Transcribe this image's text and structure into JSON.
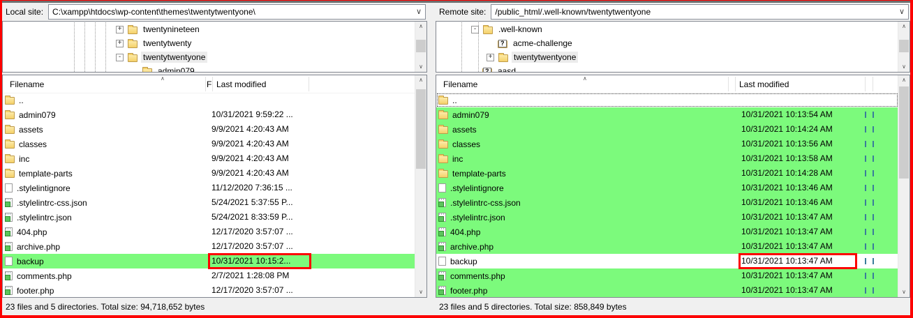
{
  "colors": {
    "compare_green": "#7cfa7c",
    "annotation_red": "#fd0000"
  },
  "local": {
    "label": "Local site:",
    "path": "C:\\xampp\\htdocs\\wp-content\\themes\\twentytwentyone\\",
    "tree": [
      {
        "name": "twentynineteen",
        "expander": "+",
        "icon": "folder",
        "level": 0,
        "selected": false
      },
      {
        "name": "twentytwenty",
        "expander": "+",
        "icon": "folder",
        "level": 0,
        "selected": false
      },
      {
        "name": "twentytwentyone",
        "expander": "-",
        "icon": "folder",
        "level": 0,
        "selected": true
      },
      {
        "name": "admin079",
        "expander": "",
        "icon": "folder",
        "level": 1,
        "selected": false
      }
    ],
    "columns": [
      "Filename",
      "F",
      "Last modified"
    ],
    "rows": [
      {
        "name": "..",
        "icon": "folder",
        "modified": "",
        "highlight": false
      },
      {
        "name": "admin079",
        "icon": "folder",
        "modified": "10/31/2021 9:59:22 ...",
        "highlight": false
      },
      {
        "name": "assets",
        "icon": "folder",
        "modified": "9/9/2021 4:20:43 AM",
        "highlight": false
      },
      {
        "name": "classes",
        "icon": "folder",
        "modified": "9/9/2021 4:20:43 AM",
        "highlight": false
      },
      {
        "name": "inc",
        "icon": "folder",
        "modified": "9/9/2021 4:20:43 AM",
        "highlight": false
      },
      {
        "name": "template-parts",
        "icon": "folder",
        "modified": "9/9/2021 4:20:43 AM",
        "highlight": false
      },
      {
        "name": ".stylelintignore",
        "icon": "file",
        "modified": "11/12/2020 7:36:15 ...",
        "highlight": false
      },
      {
        "name": ".stylelintrc-css.json",
        "icon": "script",
        "modified": "5/24/2021 5:37:55 P...",
        "highlight": false
      },
      {
        "name": ".stylelintrc.json",
        "icon": "script",
        "modified": "5/24/2021 8:33:59 P...",
        "highlight": false
      },
      {
        "name": "404.php",
        "icon": "script",
        "modified": "12/17/2020 3:57:07 ...",
        "highlight": false
      },
      {
        "name": "archive.php",
        "icon": "script",
        "modified": "12/17/2020 3:57:07 ...",
        "highlight": false
      },
      {
        "name": "backup",
        "icon": "file",
        "modified": "10/31/2021 10:15:2...",
        "highlight": true,
        "red_box": true
      },
      {
        "name": "comments.php",
        "icon": "script",
        "modified": "2/7/2021 1:28:08 PM",
        "highlight": false
      },
      {
        "name": "footer.php",
        "icon": "script",
        "modified": "12/17/2020 3:57:07 ...",
        "highlight": false
      }
    ],
    "status": "23 files and 5 directories. Total size: 94,718,652 bytes"
  },
  "remote": {
    "label": "Remote site:",
    "path": "/public_html/.well-known/twentytwentyone",
    "tree": [
      {
        "name": ".well-known",
        "expander": "-",
        "icon": "folder",
        "level": 0,
        "selected": false
      },
      {
        "name": "acme-challenge",
        "expander": "",
        "icon": "qfolder",
        "level": 1,
        "selected": false
      },
      {
        "name": "twentytwentyone",
        "expander": "+",
        "icon": "folder",
        "level": 1,
        "selected": true
      },
      {
        "name": "aasd",
        "expander": "",
        "icon": "qfolder",
        "level": 0,
        "selected": false
      }
    ],
    "columns": [
      "Filename",
      "Last modified"
    ],
    "rows": [
      {
        "name": "..",
        "icon": "folder",
        "modified": "",
        "highlight": false,
        "focus": true
      },
      {
        "name": "admin079",
        "icon": "folder",
        "modified": "10/31/2021 10:13:54 AM",
        "highlight": true
      },
      {
        "name": "assets",
        "icon": "folder",
        "modified": "10/31/2021 10:14:24 AM",
        "highlight": true
      },
      {
        "name": "classes",
        "icon": "folder",
        "modified": "10/31/2021 10:13:56 AM",
        "highlight": true
      },
      {
        "name": "inc",
        "icon": "folder",
        "modified": "10/31/2021 10:13:58 AM",
        "highlight": true
      },
      {
        "name": "template-parts",
        "icon": "folder",
        "modified": "10/31/2021 10:14:28 AM",
        "highlight": true
      },
      {
        "name": ".stylelintignore",
        "icon": "file",
        "modified": "10/31/2021 10:13:46 AM",
        "highlight": true
      },
      {
        "name": ".stylelintrc-css.json",
        "icon": "script",
        "modified": "10/31/2021 10:13:46 AM",
        "highlight": true
      },
      {
        "name": ".stylelintrc.json",
        "icon": "script",
        "modified": "10/31/2021 10:13:47 AM",
        "highlight": true
      },
      {
        "name": "404.php",
        "icon": "script",
        "modified": "10/31/2021 10:13:47 AM",
        "highlight": true
      },
      {
        "name": "archive.php",
        "icon": "script",
        "modified": "10/31/2021 10:13:47 AM",
        "highlight": true
      },
      {
        "name": "backup",
        "icon": "file",
        "modified": "10/31/2021 10:13:47 AM",
        "highlight": false,
        "red_box": true
      },
      {
        "name": "comments.php",
        "icon": "script",
        "modified": "10/31/2021 10:13:47 AM",
        "highlight": true
      },
      {
        "name": "footer.php",
        "icon": "script",
        "modified": "10/31/2021 10:13:47 AM",
        "highlight": true
      }
    ],
    "status": "23 files and 5 directories. Total size: 858,849 bytes"
  }
}
